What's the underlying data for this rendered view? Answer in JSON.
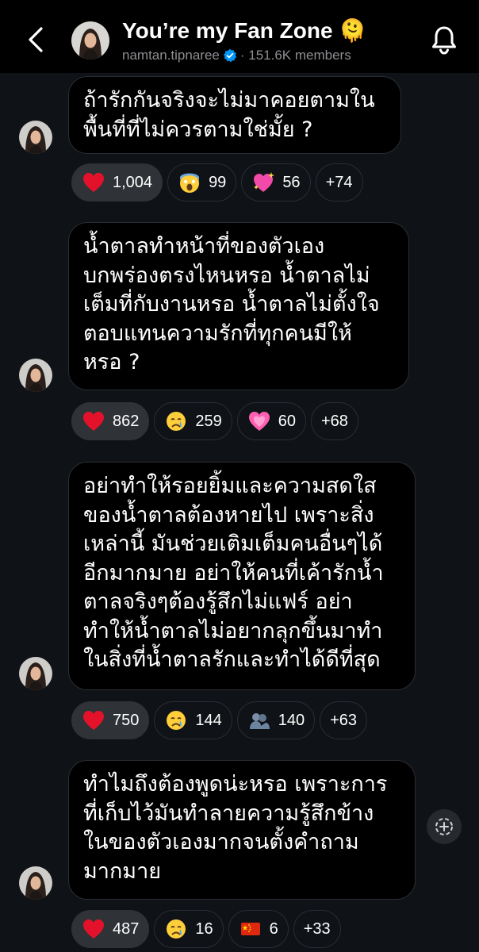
{
  "header": {
    "title": "You’re my Fan Zone 🫠",
    "username": "namtan.tipnaree",
    "members": "· 151.6K members"
  },
  "messages": [
    {
      "text": "ถ้ารักกันจริงจะไม่มาคอยตามใน\nพื้นที่ที่ไม่ควรตามใช่มั้ย ?",
      "reactions": [
        {
          "emoji": "heart",
          "count": "1,004"
        },
        {
          "emoji": "scream",
          "count": "99"
        },
        {
          "emoji": "sparkling-heart",
          "count": "56"
        },
        {
          "emoji": "",
          "count": "+74"
        }
      ]
    },
    {
      "text": "น้ำตาลทำหน้าที่ของตัวเอง\nบกพร่องตรงไหนหรอ น้ำตาลไม่\nเต็มที่กับงานหรอ น้ำตาลไม่ตั้งใจ\nตอบแทนความรักที่ทุกคนมีให้\nหรอ ?",
      "reactions": [
        {
          "emoji": "heart",
          "count": "862"
        },
        {
          "emoji": "crying",
          "count": "259"
        },
        {
          "emoji": "pink-heart",
          "count": "60"
        },
        {
          "emoji": "",
          "count": "+68"
        }
      ]
    },
    {
      "text": "อย่าทำให้รอยยิ้มและความสดใส\nของน้ำตาลต้องหายไป เพราะสิ่ง\nเหล่านี้ มันช่วยเติมเต็มคนอื่นๆได้\nอีกมากมาย อย่าให้คนที่เค้ารักน้ำ\nตาลจริงๆต้องรู้สึกไม่แฟร์ อย่า\nทำให้น้ำตาลไม่อยากลุกขึ้นมาทำ\nในสิ่งที่น้ำตาลรักและทำได้ดีที่สุด",
      "reactions": [
        {
          "emoji": "heart",
          "count": "750"
        },
        {
          "emoji": "crying",
          "count": "144"
        },
        {
          "emoji": "hugging-people",
          "count": "140"
        },
        {
          "emoji": "",
          "count": "+63"
        }
      ]
    },
    {
      "text": "ทำไมถึงต้องพูดน่ะหรอ เพราะการ\nที่เก็บไว้มันทำลายความรู้สึกข้าง\nในของตัวเองมากจนตั้งคำถาม\nมากมาย",
      "reactions": [
        {
          "emoji": "heart",
          "count": "487"
        },
        {
          "emoji": "crying",
          "count": "16"
        },
        {
          "emoji": "china-flag",
          "count": "6"
        },
        {
          "emoji": "",
          "count": "+33"
        }
      ]
    }
  ]
}
